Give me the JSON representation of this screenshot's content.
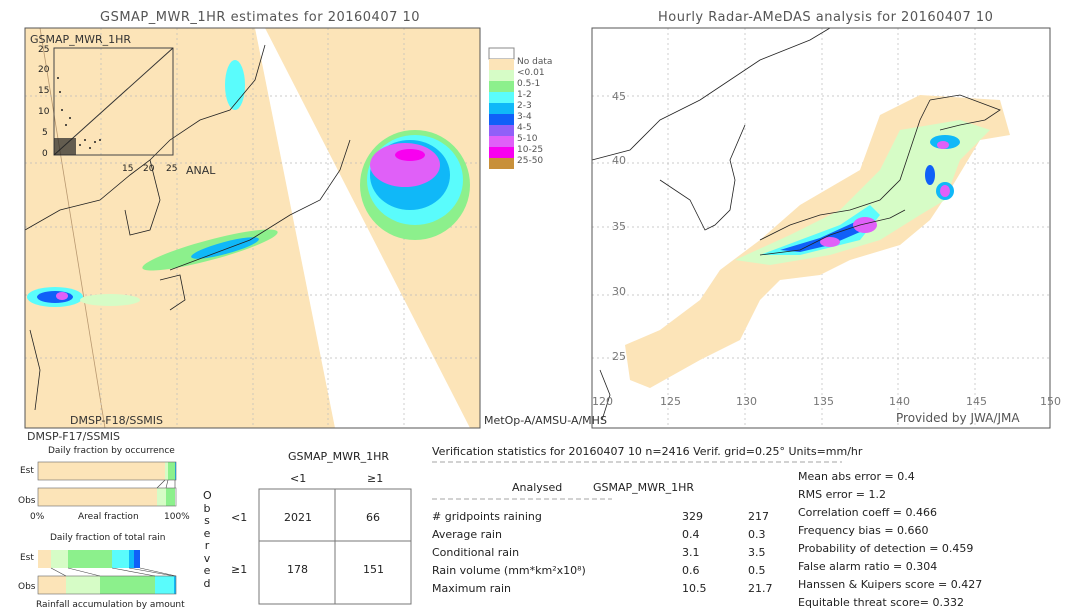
{
  "left_map": {
    "title": "GSMAP_MWR_1HR estimates for 20160407 10",
    "inset_ylabel": "GSMAP_MWR_1HR",
    "inset_xlabel": "ANAL",
    "inset_ticks": [
      "0",
      "5",
      "10",
      "15",
      "20",
      "25"
    ],
    "sensors": [
      "DMSP-F18/SSMIS",
      "MetOp-A/AMSU-A/MHS",
      "DMSP-F17/SSMIS"
    ]
  },
  "right_map": {
    "title": "Hourly Radar-AMeDAS analysis for 20160407 10",
    "lon_ticks": [
      "120",
      "125",
      "130",
      "135",
      "140",
      "145",
      "150"
    ],
    "lat_ticks": [
      "45",
      "40",
      "35",
      "30",
      "25"
    ],
    "credit": "Provided by JWA/JMA"
  },
  "legend": {
    "items": [
      {
        "label": "",
        "color": "#ffffff"
      },
      {
        "label": "No data",
        "color": "#fce4b8"
      },
      {
        "label": "<0.01",
        "color": "#d6fcc6"
      },
      {
        "label": "0.5-1",
        "color": "#8cf08c"
      },
      {
        "label": "1-2",
        "color": "#5afcfc"
      },
      {
        "label": "2-3",
        "color": "#10b8f8"
      },
      {
        "label": "3-4",
        "color": "#1060f8"
      },
      {
        "label": "4-5",
        "color": "#9060f8"
      },
      {
        "label": "5-10",
        "color": "#e060f8"
      },
      {
        "label": "10-25",
        "color": "#f800f0"
      },
      {
        "label": "25-50",
        "color": "#c8903a"
      }
    ]
  },
  "occurrence": {
    "title": "Daily fraction by occurrence",
    "est": "Est",
    "obs": "Obs",
    "x_min": "0%",
    "x_label": "Areal fraction",
    "x_max": "100%"
  },
  "total_rain": {
    "title": "Daily fraction of total rain",
    "est": "Est",
    "obs": "Obs",
    "footer": "Rainfall accumulation by amount"
  },
  "contingency": {
    "title": "GSMAP_MWR_1HR",
    "col_labels": [
      "<1",
      "≥1"
    ],
    "row_labels": [
      "<1",
      "≥1"
    ],
    "observed_label": "Observed",
    "cells": [
      [
        "2021",
        "66"
      ],
      [
        "178",
        "151"
      ]
    ]
  },
  "stats": {
    "header": "Verification statistics for 20160407 10   n=2416   Verif. grid=0.25°   Units=mm/hr",
    "col_analysed": "Analysed",
    "col_gsmap": "GSMAP_MWR_1HR",
    "rows": [
      {
        "label": "# gridpoints raining",
        "a": "329",
        "g": "217"
      },
      {
        "label": "Average rain",
        "a": "0.4",
        "g": "0.3"
      },
      {
        "label": "Conditional rain",
        "a": "3.1",
        "g": "3.5"
      },
      {
        "label": "Rain volume (mm*km²x10⁸)",
        "a": "0.6",
        "g": "0.5"
      },
      {
        "label": "Maximum rain",
        "a": "10.5",
        "g": "21.7"
      }
    ],
    "scores": [
      "Mean abs error = 0.4",
      "RMS error = 1.2",
      "Correlation coeff = 0.466",
      "Frequency bias = 0.660",
      "Probability of detection = 0.459",
      "False alarm ratio = 0.304",
      "Hanssen & Kuipers score = 0.427",
      "Equitable threat score= 0.332"
    ]
  }
}
